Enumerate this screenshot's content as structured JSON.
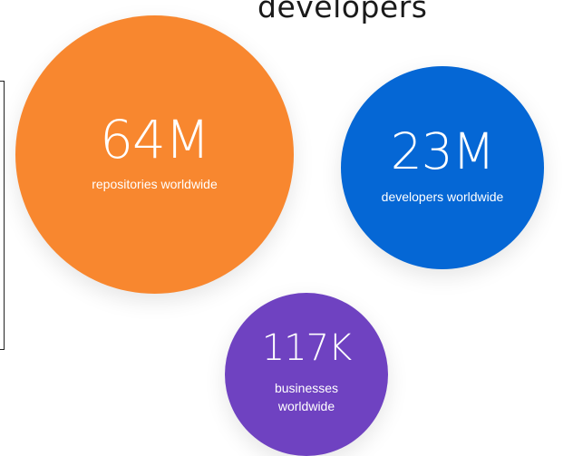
{
  "heading": "developers",
  "colors": {
    "repos": "#F8872F",
    "developers": "#0567D5",
    "businesses": "#6F42C1"
  },
  "stats": {
    "repositories": {
      "value": "64M",
      "caption": "repositories worldwide"
    },
    "developers": {
      "value": "23M",
      "caption": "developers worldwide"
    },
    "businesses": {
      "value": "117K",
      "caption": "businesses worldwide"
    }
  }
}
